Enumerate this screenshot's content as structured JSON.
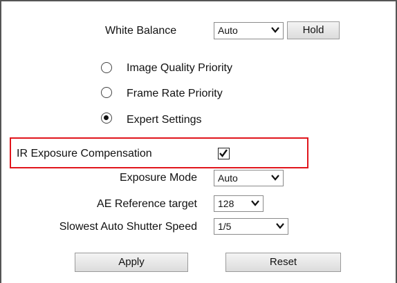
{
  "white_balance": {
    "label": "White Balance",
    "value": "Auto",
    "hold_label": "Hold"
  },
  "priority_options": [
    {
      "label": "Image Quality Priority",
      "selected": false
    },
    {
      "label": "Frame Rate Priority",
      "selected": false
    },
    {
      "label": "Expert Settings",
      "selected": true
    }
  ],
  "ir_compensation": {
    "label": "IR Exposure Compensation",
    "checked": true
  },
  "exposure_mode": {
    "label": "Exposure Mode",
    "value": "Auto"
  },
  "ae_reference": {
    "label": "AE Reference target",
    "value": "128"
  },
  "slowest_shutter": {
    "label": "Slowest Auto Shutter Speed",
    "value": "1/5"
  },
  "actions": {
    "apply_label": "Apply",
    "reset_label": "Reset"
  },
  "colors": {
    "highlight": "#e0141b"
  }
}
